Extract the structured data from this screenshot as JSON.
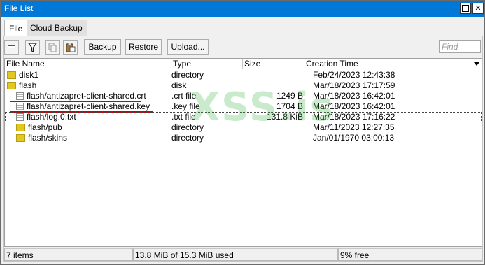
{
  "window": {
    "title": "File List"
  },
  "tabs": [
    {
      "label": "File"
    },
    {
      "label": "Cloud Backup"
    }
  ],
  "toolbar": {
    "backup_label": "Backup",
    "restore_label": "Restore",
    "upload_label": "Upload...",
    "find_placeholder": "Find",
    "icons": [
      "minus-icon",
      "filter-icon",
      "copy-icon",
      "paste-icon"
    ]
  },
  "table": {
    "columns": [
      "File Name",
      "Type",
      "Size",
      "Creation Time"
    ],
    "rows": [
      {
        "name": "disk1",
        "type": "directory",
        "size": "",
        "time": "Feb/24/2023 12:43:38",
        "icon": "folder-icon",
        "indent": 0
      },
      {
        "name": "flash",
        "type": "disk",
        "size": "",
        "time": "Mar/18/2023 17:17:59",
        "icon": "folder-icon",
        "indent": 0
      },
      {
        "name": "flash/antizapret-client-shared.crt",
        "type": ".crt file",
        "size": "1249 B",
        "time": "Mar/18/2023 16:42:01",
        "icon": "file-icon",
        "indent": 1
      },
      {
        "name": "flash/antizapret-client-shared.key",
        "type": ".key file",
        "size": "1704 B",
        "time": "Mar/18/2023 16:42:01",
        "icon": "file-icon",
        "indent": 1
      },
      {
        "name": "flash/log.0.txt",
        "type": ".txt file",
        "size": "131.8 KiB",
        "time": "Mar/18/2023 17:16:22",
        "icon": "file-icon",
        "indent": 1
      },
      {
        "name": "flash/pub",
        "type": "directory",
        "size": "",
        "time": "Mar/11/2023 12:27:35",
        "icon": "folder-icon",
        "indent": 1
      },
      {
        "name": "flash/skins",
        "type": "directory",
        "size": "",
        "time": "Jan/01/1970 03:00:13",
        "icon": "folder-icon",
        "indent": 1
      }
    ]
  },
  "status": {
    "items": "7 items",
    "usage": "13.8 MiB of 15.3 MiB used",
    "free": "9% free"
  },
  "watermark": "XSS.is",
  "colors": {
    "titlebar": "#0078d7",
    "folder": "#e1c81e",
    "annotation_underline": "#d40000",
    "watermark": "#3cb446"
  }
}
